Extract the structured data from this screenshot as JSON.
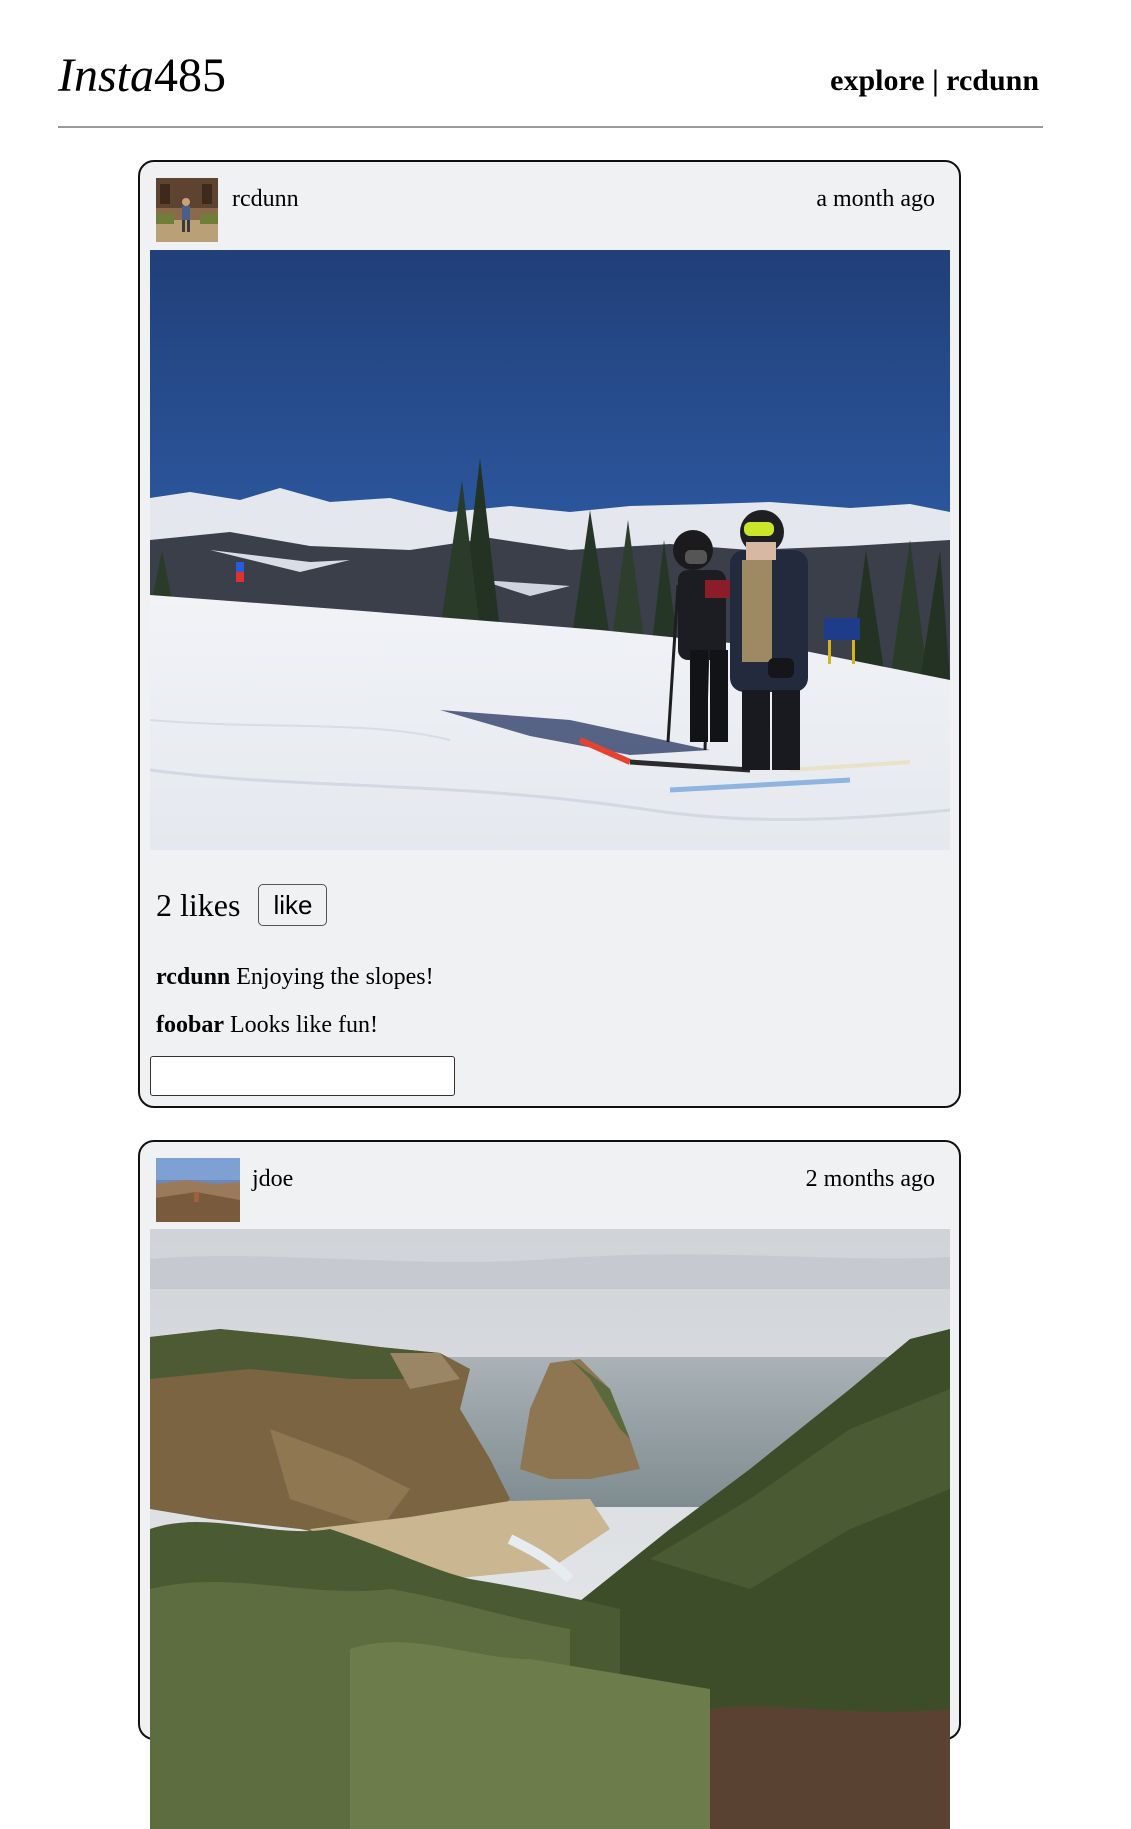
{
  "header": {
    "logo_italic": "Insta",
    "logo_rest": "485",
    "explore_link": "explore",
    "separator": " | ",
    "user_link": "rcdunn"
  },
  "posts": [
    {
      "owner": "rcdunn",
      "timestamp": "a month ago",
      "likes_text": "2 likes",
      "like_button": "like",
      "photo_icon": "ski-slope-photo",
      "comments": [
        {
          "user": "rcdunn",
          "text": "Enjoying the slopes!"
        },
        {
          "user": "foobar",
          "text": "Looks like fun!"
        }
      ],
      "comment_input_value": ""
    },
    {
      "owner": "jdoe",
      "timestamp": "2 months ago",
      "photo_icon": "coastal-cliffs-photo"
    }
  ]
}
